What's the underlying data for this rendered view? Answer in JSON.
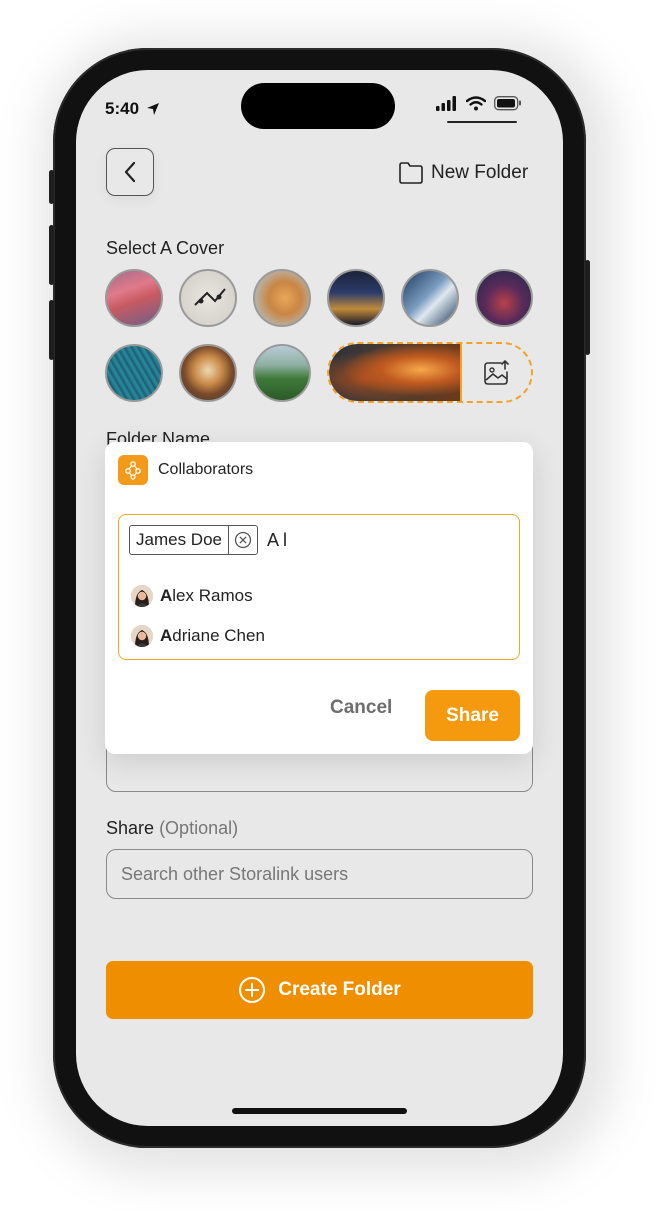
{
  "status_bar": {
    "time": "5:40"
  },
  "header": {
    "new_folder_label": "New Folder"
  },
  "cover_section": {
    "label": "Select A Cover"
  },
  "folder_name_section": {
    "label": "Folder Name"
  },
  "share_section": {
    "label": "Share",
    "optional": "(Optional)",
    "search_placeholder": "Search other Storalink users"
  },
  "create_button": {
    "label": "Create Folder"
  },
  "modal": {
    "title": "Collaborators",
    "chip_name": "James Doe",
    "typed_query": "A l",
    "suggestions": [
      {
        "match": "A",
        "rest": "lex Ramos"
      },
      {
        "match": "A",
        "rest": "driane Chen"
      }
    ],
    "cancel_label": "Cancel",
    "share_label": "Share"
  },
  "colors": {
    "accent": "#EF8F00",
    "accent_border": "#F0A72B",
    "screen_bg": "#E8E8E8"
  },
  "icons": [
    "location-arrow-icon",
    "signal-icon",
    "wifi-icon",
    "battery-icon",
    "chevron-left-icon",
    "folder-icon",
    "image-upload-icon",
    "collaborators-icon",
    "remove-circle-icon",
    "plus-circle-icon"
  ]
}
